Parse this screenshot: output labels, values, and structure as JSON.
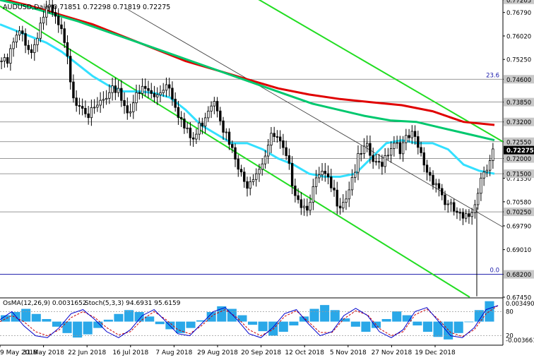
{
  "chart_data": {
    "type": "candlestick",
    "symbol": "AUDUSD",
    "timeframe": "Daily",
    "ohlc_header": "AUDUSD,Daily  0.71851 0.72298 0.71819 0.72275",
    "current_price": "0.72275",
    "y_range": [
      0.6745,
      0.772
    ],
    "y_tick_labels": [
      "0.77205",
      "0.76790",
      "0.76020",
      "0.75250",
      "0.74600",
      "0.73850",
      "0.73200",
      "0.72550",
      "0.72000",
      "0.71350",
      "0.71500",
      "0.70580",
      "0.70250",
      "0.69790",
      "0.69010",
      "0.68200",
      "0.67450"
    ],
    "y_ticks": [
      {
        "label": "0.77205",
        "value": 0.77205,
        "tagged": true
      },
      {
        "label": "0.76790",
        "value": 0.7679,
        "tagged": false
      },
      {
        "label": "0.76020",
        "value": 0.7602,
        "tagged": false
      },
      {
        "label": "0.75250",
        "value": 0.7525,
        "tagged": false
      },
      {
        "label": "0.74600",
        "value": 0.746,
        "tagged": true
      },
      {
        "label": "0.73850",
        "value": 0.7385,
        "tagged": true
      },
      {
        "label": "0.73200",
        "value": 0.732,
        "tagged": true
      },
      {
        "label": "0.72550",
        "value": 0.7255,
        "tagged": true
      },
      {
        "label": "0.72000",
        "value": 0.72,
        "tagged": true
      },
      {
        "label": "0.71350",
        "value": 0.7135,
        "tagged": false
      },
      {
        "label": "0.71500",
        "value": 0.715,
        "tagged": true
      },
      {
        "label": "0.70580",
        "value": 0.7058,
        "tagged": false
      },
      {
        "label": "0.70250",
        "value": 0.7025,
        "tagged": true
      },
      {
        "label": "0.69790",
        "value": 0.6979,
        "tagged": false
      },
      {
        "label": "0.69010",
        "value": 0.6901,
        "tagged": false
      },
      {
        "label": "0.68200",
        "value": 0.682,
        "tagged": true
      },
      {
        "label": "0.67450",
        "value": 0.6745,
        "tagged": false
      }
    ],
    "x_tick_labels": [
      "9 May 2018",
      "31 May 2018",
      "22 Jun 2018",
      "16 Jul 2018",
      "7 Aug 2018",
      "29 Aug 2018",
      "20 Sep 2018",
      "12 Oct 2018",
      "5 Nov 2018",
      "27 Nov 2018",
      "19 Dec 2018"
    ],
    "x_tick_positions": [
      0.0,
      0.088,
      0.176,
      0.264,
      0.352,
      0.44,
      0.528,
      0.616,
      0.704,
      0.792,
      0.88
    ],
    "fib_labels": [
      "23.6",
      "0.0"
    ],
    "horizontal_levels": [
      0.7255,
      0.72,
      0.715,
      0.7025,
      0.732,
      0.7385,
      0.746
    ],
    "fib_levels": {
      "23.6": 0.746,
      "0.0": 0.682
    },
    "close_series": [
      0.752,
      0.75,
      0.756,
      0.7595,
      0.761,
      0.758,
      0.7545,
      0.761,
      0.766,
      0.769,
      0.767,
      0.764,
      0.76,
      0.752,
      0.743,
      0.738,
      0.739,
      0.735,
      0.734,
      0.737,
      0.739,
      0.738,
      0.742,
      0.744,
      0.738,
      0.736,
      0.739,
      0.74,
      0.743,
      0.742,
      0.7395,
      0.742,
      0.744,
      0.745,
      0.74,
      0.735,
      0.73,
      0.727,
      0.726,
      0.73,
      0.734,
      0.738,
      0.74,
      0.736,
      0.729,
      0.724,
      0.72,
      0.715,
      0.711,
      0.714,
      0.716,
      0.718,
      0.722,
      0.726,
      0.727,
      0.724,
      0.72,
      0.715,
      0.71,
      0.706,
      0.704,
      0.708,
      0.711,
      0.715,
      0.713,
      0.71,
      0.707,
      0.706,
      0.708,
      0.713,
      0.718,
      0.721,
      0.723,
      0.72,
      0.717,
      0.719,
      0.722,
      0.725,
      0.726,
      0.723,
      0.726,
      0.727,
      0.724,
      0.72,
      0.716,
      0.714,
      0.712,
      0.708,
      0.704,
      0.703,
      0.702,
      0.699,
      0.7,
      0.704,
      0.71,
      0.716,
      0.719,
      0.7227
    ],
    "ma_fast_cyan": [
      0.764,
      0.762,
      0.76,
      0.758,
      0.755,
      0.751,
      0.747,
      0.744,
      0.742,
      0.742,
      0.7415,
      0.74,
      0.736,
      0.731,
      0.728,
      0.725,
      0.725,
      0.723,
      0.72,
      0.718,
      0.715,
      0.714,
      0.714,
      0.715,
      0.72,
      0.725,
      0.726,
      0.725,
      0.725,
      0.723,
      0.718,
      0.716,
      0.715
    ],
    "ma_mid_green": [
      0.772,
      0.77,
      0.7675,
      0.765,
      0.762,
      0.759,
      0.756,
      0.753,
      0.75,
      0.747,
      0.744,
      0.741,
      0.738,
      0.736,
      0.734,
      0.7325,
      0.732,
      0.73,
      0.728,
      0.726
    ],
    "ma_slow_red": [
      0.7725,
      0.77,
      0.767,
      0.764,
      0.76,
      0.756,
      0.752,
      0.749,
      0.746,
      0.743,
      0.741,
      0.7395,
      0.7385,
      0.7375,
      0.7355,
      0.732,
      0.731
    ],
    "oscillator": {
      "osma_label": "OsMA(12,26,9) 0.0031652",
      "stoch_label": "Stoch(5,3,3) 94.6931 95.6159",
      "right_labels": [
        "0.0034902",
        "80",
        "20",
        "-0.003661"
      ],
      "osma_values": [
        0.001,
        0.0015,
        0.002,
        0.0012,
        0.0004,
        -0.0008,
        -0.0018,
        -0.0025,
        -0.002,
        -0.001,
        0.0003,
        0.0012,
        0.0018,
        0.0015,
        0.0008,
        -0.0004,
        -0.0012,
        -0.0018,
        -0.001,
        0.0002,
        0.0015,
        0.0024,
        0.002,
        0.001,
        -0.0005,
        -0.0015,
        -0.0022,
        -0.0016,
        -0.0006,
        0.0008,
        0.002,
        0.0026,
        0.0018,
        0.0005,
        -0.0008,
        -0.0016,
        -0.001,
        0.0004,
        0.0016,
        0.001,
        -0.0006,
        -0.0016,
        -0.0024,
        -0.0028,
        -0.0018,
        0.0,
        0.0018,
        0.0032
      ],
      "stoch_k": [
        60,
        80,
        45,
        20,
        15,
        40,
        75,
        85,
        60,
        30,
        15,
        35,
        70,
        85,
        55,
        25,
        20,
        50,
        80,
        90,
        60,
        25,
        15,
        40,
        75,
        85,
        50,
        20,
        30,
        70,
        88,
        70,
        30,
        15,
        35,
        80,
        90,
        55,
        20,
        15,
        40,
        85,
        95
      ],
      "stoch_d": [
        55,
        70,
        55,
        30,
        20,
        35,
        65,
        80,
        65,
        40,
        22,
        30,
        60,
        80,
        60,
        35,
        25,
        45,
        72,
        85,
        65,
        35,
        20,
        35,
        68,
        82,
        55,
        28,
        28,
        62,
        82,
        72,
        38,
        20,
        30,
        72,
        86,
        60,
        28,
        18,
        35,
        75,
        95
      ]
    },
    "colors": {
      "bull_candle": "#000000",
      "bear_candle": "#000000",
      "ma_fast": "#33e0ff",
      "ma_mid": "#00c86e",
      "ma_slow": "#e00000",
      "channel": "#22dd22",
      "fib_line": "#1a1aaa",
      "osma_bar": "#2aa8e8",
      "stoch_k": "#0000cc",
      "stoch_d": "#cc0000",
      "price_tag_bg": "#c8c8c8",
      "current_tag_bg": "#000000"
    }
  }
}
